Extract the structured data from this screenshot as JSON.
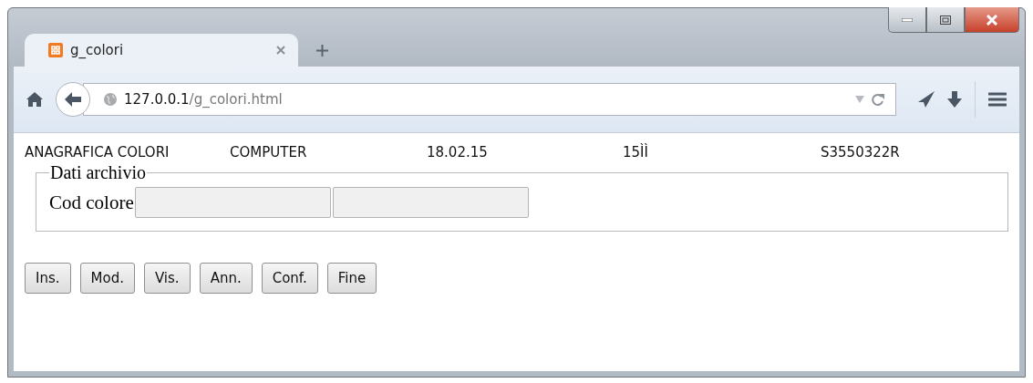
{
  "tabs": [
    {
      "title": "g_colori",
      "selected": true
    }
  ],
  "address_bar": {
    "host": "127.0.0.1",
    "path": "/g_colori.html"
  },
  "header": [
    "ANAGRAFICA COLORI",
    "COMPUTER",
    "18.02.15",
    "15ÌÌ",
    "S3550322R"
  ],
  "fieldset": {
    "legend": "Dati archivio",
    "label": "Cod colore",
    "fields": [
      {
        "disabled": true
      },
      {
        "disabled": true
      }
    ]
  },
  "buttons": [
    "Ins.",
    "Mod.",
    "Vis.",
    "Ann.",
    "Conf.",
    "Fine"
  ]
}
